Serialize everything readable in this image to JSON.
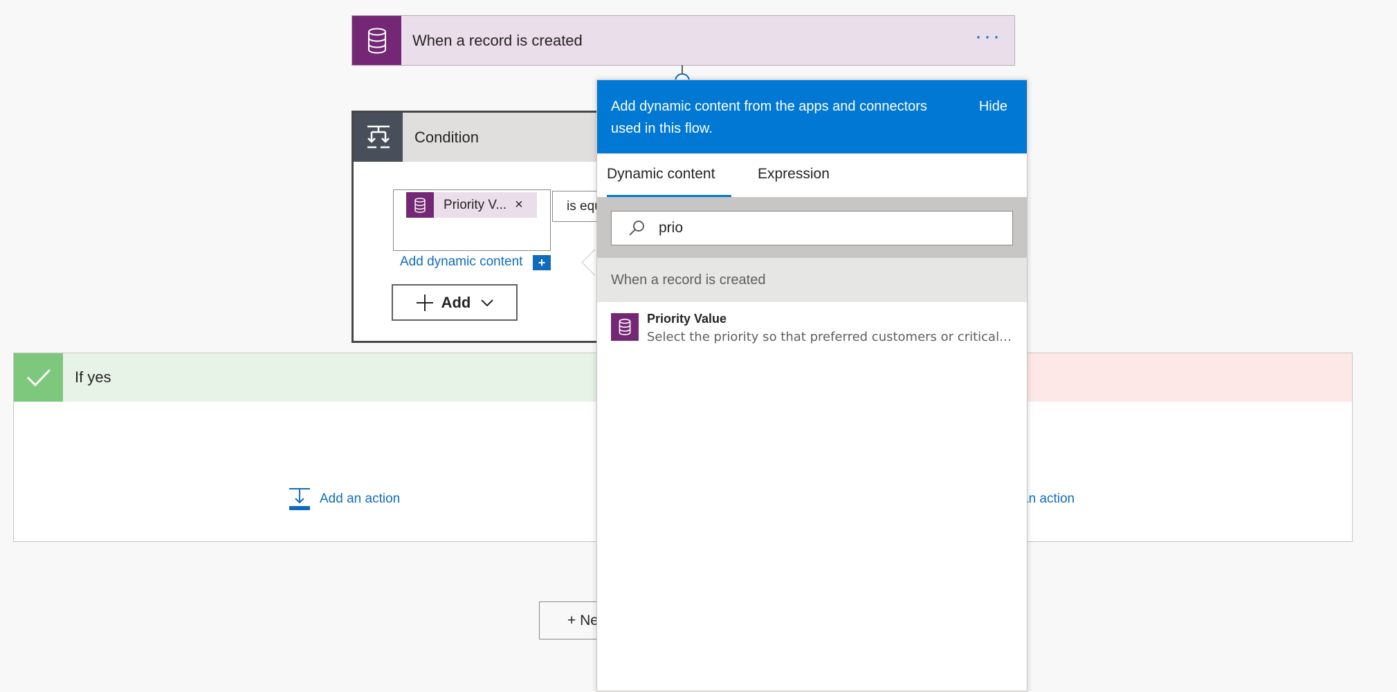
{
  "trigger": {
    "title": "When a record is created",
    "more_label": "···"
  },
  "condition": {
    "title": "Condition",
    "token_label": "Priority V...",
    "token_remove": "×",
    "operator": "is equal to",
    "add_dynamic_label": "Add dynamic content",
    "add_dynamic_plus": "+",
    "add_label": "Add"
  },
  "branches": {
    "yes_title": "If yes",
    "yes_add_action": "Add an action",
    "no_add_action": "an action",
    "new_step_label": "+ New step"
  },
  "panel": {
    "header": "Add dynamic content from the apps and connectors used in this flow.",
    "hide_label": "Hide",
    "tabs": [
      "Dynamic content",
      "Expression"
    ],
    "search_value": "prio",
    "group_title": "When a record is created",
    "items": [
      {
        "name": "Priority Value",
        "description": "Select the priority so that preferred customers or critical issues are handled quickly."
      }
    ]
  },
  "colors": {
    "accent": "#0078d4",
    "connector": "#742774",
    "yes": "#7dc87d",
    "no": "#fde7e7"
  }
}
